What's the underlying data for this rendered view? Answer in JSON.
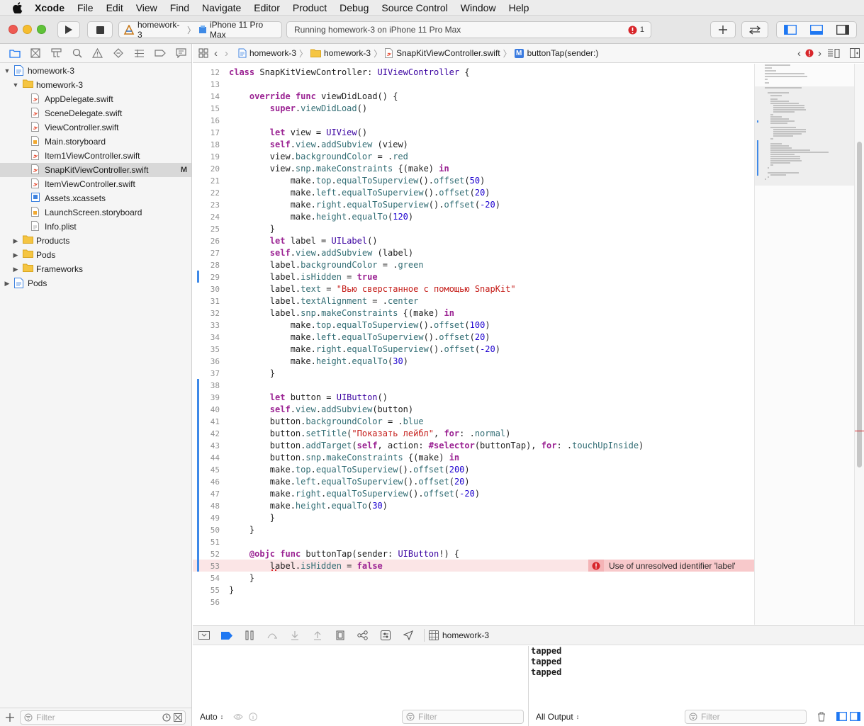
{
  "menubar": {
    "items": [
      "Xcode",
      "File",
      "Edit",
      "View",
      "Find",
      "Navigate",
      "Editor",
      "Product",
      "Debug",
      "Source Control",
      "Window",
      "Help"
    ]
  },
  "toolbar": {
    "scheme": "homework-3",
    "device": "iPhone 11 Pro Max",
    "activity_status": "Running homework-3 on iPhone 11 Pro Max",
    "error_count": "1"
  },
  "navigator": {
    "items": [
      {
        "label": "homework-3",
        "depth": 0,
        "type": "project",
        "disclosure": "open"
      },
      {
        "label": "homework-3",
        "depth": 1,
        "type": "folder",
        "disclosure": "open"
      },
      {
        "label": "AppDelegate.swift",
        "depth": 2,
        "type": "swift"
      },
      {
        "label": "SceneDelegate.swift",
        "depth": 2,
        "type": "swift"
      },
      {
        "label": "ViewController.swift",
        "depth": 2,
        "type": "swift"
      },
      {
        "label": "Main.storyboard",
        "depth": 2,
        "type": "storyboard"
      },
      {
        "label": "Item1ViewController.swift",
        "depth": 2,
        "type": "swift"
      },
      {
        "label": "SnapKitViewController.swift",
        "depth": 2,
        "type": "swift",
        "selected": true,
        "status": "M"
      },
      {
        "label": "ItemViewController.swift",
        "depth": 2,
        "type": "swift"
      },
      {
        "label": "Assets.xcassets",
        "depth": 2,
        "type": "assets"
      },
      {
        "label": "LaunchScreen.storyboard",
        "depth": 2,
        "type": "storyboard"
      },
      {
        "label": "Info.plist",
        "depth": 2,
        "type": "plist"
      },
      {
        "label": "Products",
        "depth": 1,
        "type": "folder",
        "disclosure": "closed"
      },
      {
        "label": "Pods",
        "depth": 1,
        "type": "folder",
        "disclosure": "closed"
      },
      {
        "label": "Frameworks",
        "depth": 1,
        "type": "folder",
        "disclosure": "closed"
      },
      {
        "label": "Pods",
        "depth": 0,
        "type": "project",
        "disclosure": "closed"
      }
    ],
    "filter_placeholder": "Filter"
  },
  "jumpbar": {
    "crumbs": [
      "homework-3",
      "homework-3",
      "SnapKitViewController.swift"
    ],
    "symbol_badge": "M",
    "symbol": "buttonTap(sender:)"
  },
  "editor": {
    "lines": [
      {
        "n": "12",
        "code": "class SnapKitViewController: UIViewController {"
      },
      {
        "n": "13",
        "code": ""
      },
      {
        "n": "14",
        "code": "    override func viewDidLoad() {"
      },
      {
        "n": "15",
        "code": "        super.viewDidLoad()"
      },
      {
        "n": "16",
        "code": ""
      },
      {
        "n": "17",
        "code": "        let view = UIView()"
      },
      {
        "n": "18",
        "code": "        self.view.addSubview (view)"
      },
      {
        "n": "19",
        "code": "        view.backgroundColor = .red"
      },
      {
        "n": "20",
        "code": "        view.snp.makeConstraints {(make) in"
      },
      {
        "n": "21",
        "code": "            make.top.equalToSuperview().offset(50)"
      },
      {
        "n": "22",
        "code": "            make.left.equalToSuperview().offset(20)"
      },
      {
        "n": "23",
        "code": "            make.right.equalToSuperview().offset(-20)"
      },
      {
        "n": "24",
        "code": "            make.height.equalTo(120)"
      },
      {
        "n": "25",
        "code": "        }"
      },
      {
        "n": "26",
        "code": "        let label = UILabel()"
      },
      {
        "n": "27",
        "code": "        self.view.addSubview (label)"
      },
      {
        "n": "28",
        "code": "        label.backgroundColor = .green"
      },
      {
        "n": "29",
        "code": "        label.isHidden = true"
      },
      {
        "n": "30",
        "code": "        label.text = \"Вью сверстанное с помощью SnapKit\""
      },
      {
        "n": "31",
        "code": "        label.textAlignment = .center"
      },
      {
        "n": "32",
        "code": "        label.snp.makeConstraints {(make) in"
      },
      {
        "n": "33",
        "code": "            make.top.equalToSuperview().offset(100)"
      },
      {
        "n": "34",
        "code": "            make.left.equalToSuperview().offset(20)"
      },
      {
        "n": "35",
        "code": "            make.right.equalToSuperview().offset(-20)"
      },
      {
        "n": "36",
        "code": "            make.height.equalTo(30)"
      },
      {
        "n": "37",
        "code": "        }"
      },
      {
        "n": "38",
        "code": ""
      },
      {
        "n": "39",
        "code": "        let button = UIButton()"
      },
      {
        "n": "40",
        "code": "        self.view.addSubview(button)"
      },
      {
        "n": "41",
        "code": "        button.backgroundColor = .blue"
      },
      {
        "n": "42",
        "code": "        button.setTitle(\"Показать лейбл\", for: .normal)"
      },
      {
        "n": "43",
        "code": "        button.addTarget(self, action: #selector(buttonTap), for: .touchUpInside)"
      },
      {
        "n": "44",
        "code": "        button.snp.makeConstraints {(make) in"
      },
      {
        "n": "45",
        "code": "        make.top.equalToSuperview().offset(200)"
      },
      {
        "n": "46",
        "code": "        make.left.equalToSuperview().offset(20)"
      },
      {
        "n": "47",
        "code": "        make.right.equalToSuperview().offset(-20)"
      },
      {
        "n": "48",
        "code": "        make.height.equalTo(30)"
      },
      {
        "n": "49",
        "code": "        }"
      },
      {
        "n": "50",
        "code": "    }"
      },
      {
        "n": "51",
        "code": ""
      },
      {
        "n": "52",
        "code": "    @objc func buttonTap(sender: UIButton!) {"
      },
      {
        "n": "53",
        "code": "        label.isHidden = false"
      },
      {
        "n": "54",
        "code": "    }"
      },
      {
        "n": "55",
        "code": "}"
      },
      {
        "n": "56",
        "code": ""
      }
    ],
    "error_message": "Use of unresolved identifier 'label'"
  },
  "debugbar": {
    "process": "homework-3"
  },
  "variables_view": {
    "mode": "Auto",
    "filter_placeholder": "Filter"
  },
  "console": {
    "output": [
      "tapped",
      "tapped",
      "tapped"
    ],
    "mode": "All Output",
    "filter_placeholder": "Filter"
  },
  "colors": {
    "accent": "#1e77f2",
    "error": "#d8262b",
    "error_line_bg": "#fbe5e6",
    "selection_bg": "#d8d8d8",
    "change_bar": "#3e89e8"
  }
}
